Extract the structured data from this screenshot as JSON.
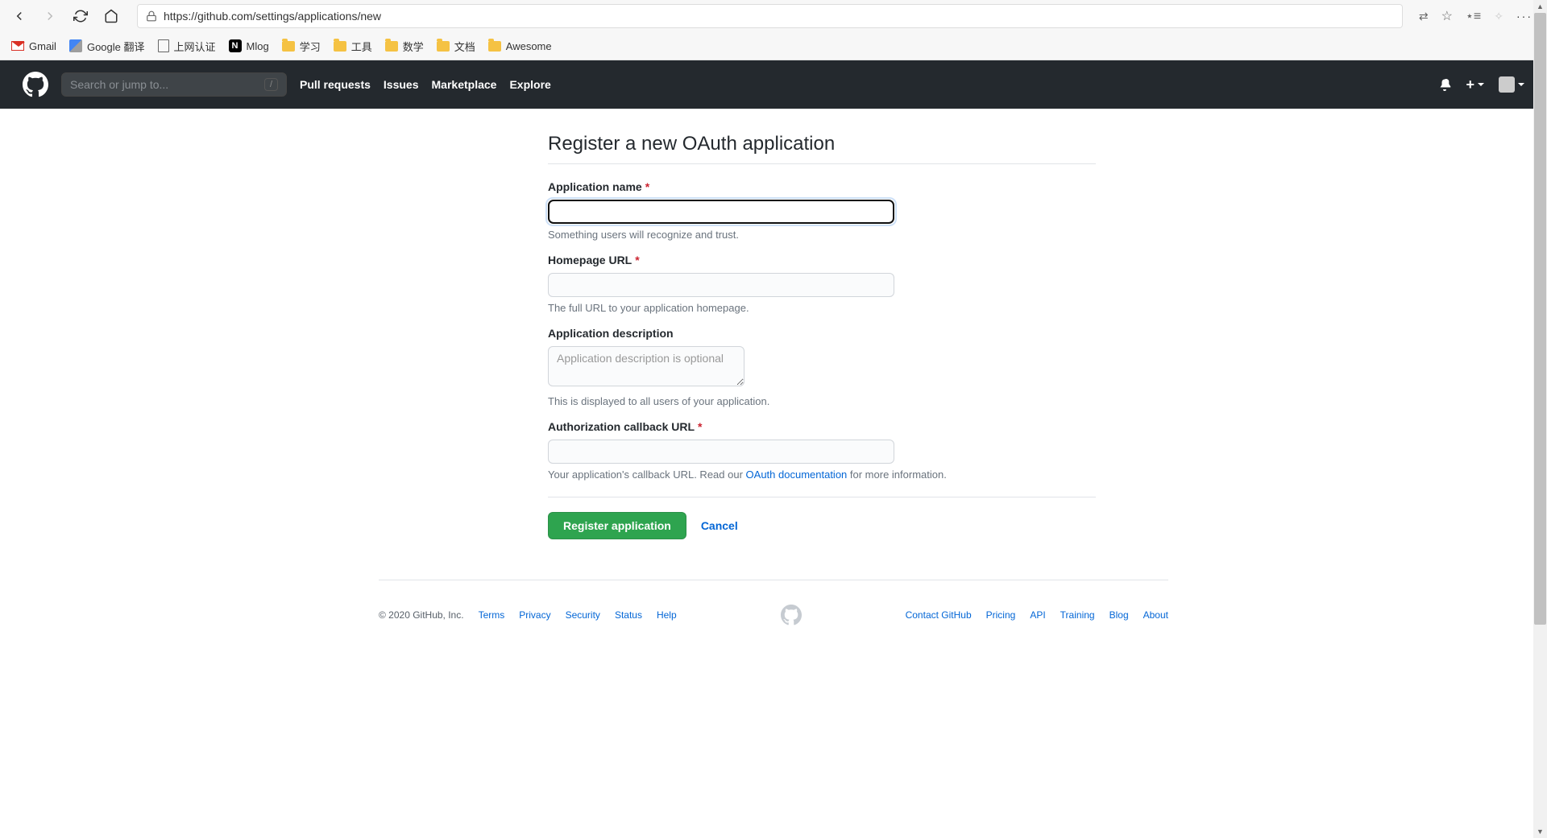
{
  "browser": {
    "url": "https://github.com/settings/applications/new",
    "bookmarks": [
      {
        "label": "Gmail",
        "icon": "gmail"
      },
      {
        "label": "Google 翻译",
        "icon": "gtranslate"
      },
      {
        "label": "上网认证",
        "icon": "page"
      },
      {
        "label": "Mlog",
        "icon": "notion"
      },
      {
        "label": "学习",
        "icon": "folder"
      },
      {
        "label": "工具",
        "icon": "folder"
      },
      {
        "label": "数学",
        "icon": "folder"
      },
      {
        "label": "文档",
        "icon": "folder"
      },
      {
        "label": "Awesome",
        "icon": "folder"
      }
    ]
  },
  "github_header": {
    "search_placeholder": "Search or jump to...",
    "nav": [
      "Pull requests",
      "Issues",
      "Marketplace",
      "Explore"
    ]
  },
  "page": {
    "title": "Register a new OAuth application"
  },
  "form": {
    "app_name": {
      "label": "Application name",
      "value": "",
      "hint": "Something users will recognize and trust."
    },
    "homepage": {
      "label": "Homepage URL",
      "value": "",
      "hint": "The full URL to your application homepage."
    },
    "description": {
      "label": "Application description",
      "value": "",
      "placeholder": "Application description is optional",
      "hint": "This is displayed to all users of your application."
    },
    "callback": {
      "label": "Authorization callback URL",
      "value": "",
      "hint_prefix": "Your application's callback URL. Read our ",
      "hint_link": "OAuth documentation",
      "hint_suffix": " for more information."
    },
    "submit": "Register application",
    "cancel": "Cancel"
  },
  "footer": {
    "copyright": "© 2020 GitHub, Inc.",
    "left": [
      "Terms",
      "Privacy",
      "Security",
      "Status",
      "Help"
    ],
    "right": [
      "Contact GitHub",
      "Pricing",
      "API",
      "Training",
      "Blog",
      "About"
    ]
  }
}
